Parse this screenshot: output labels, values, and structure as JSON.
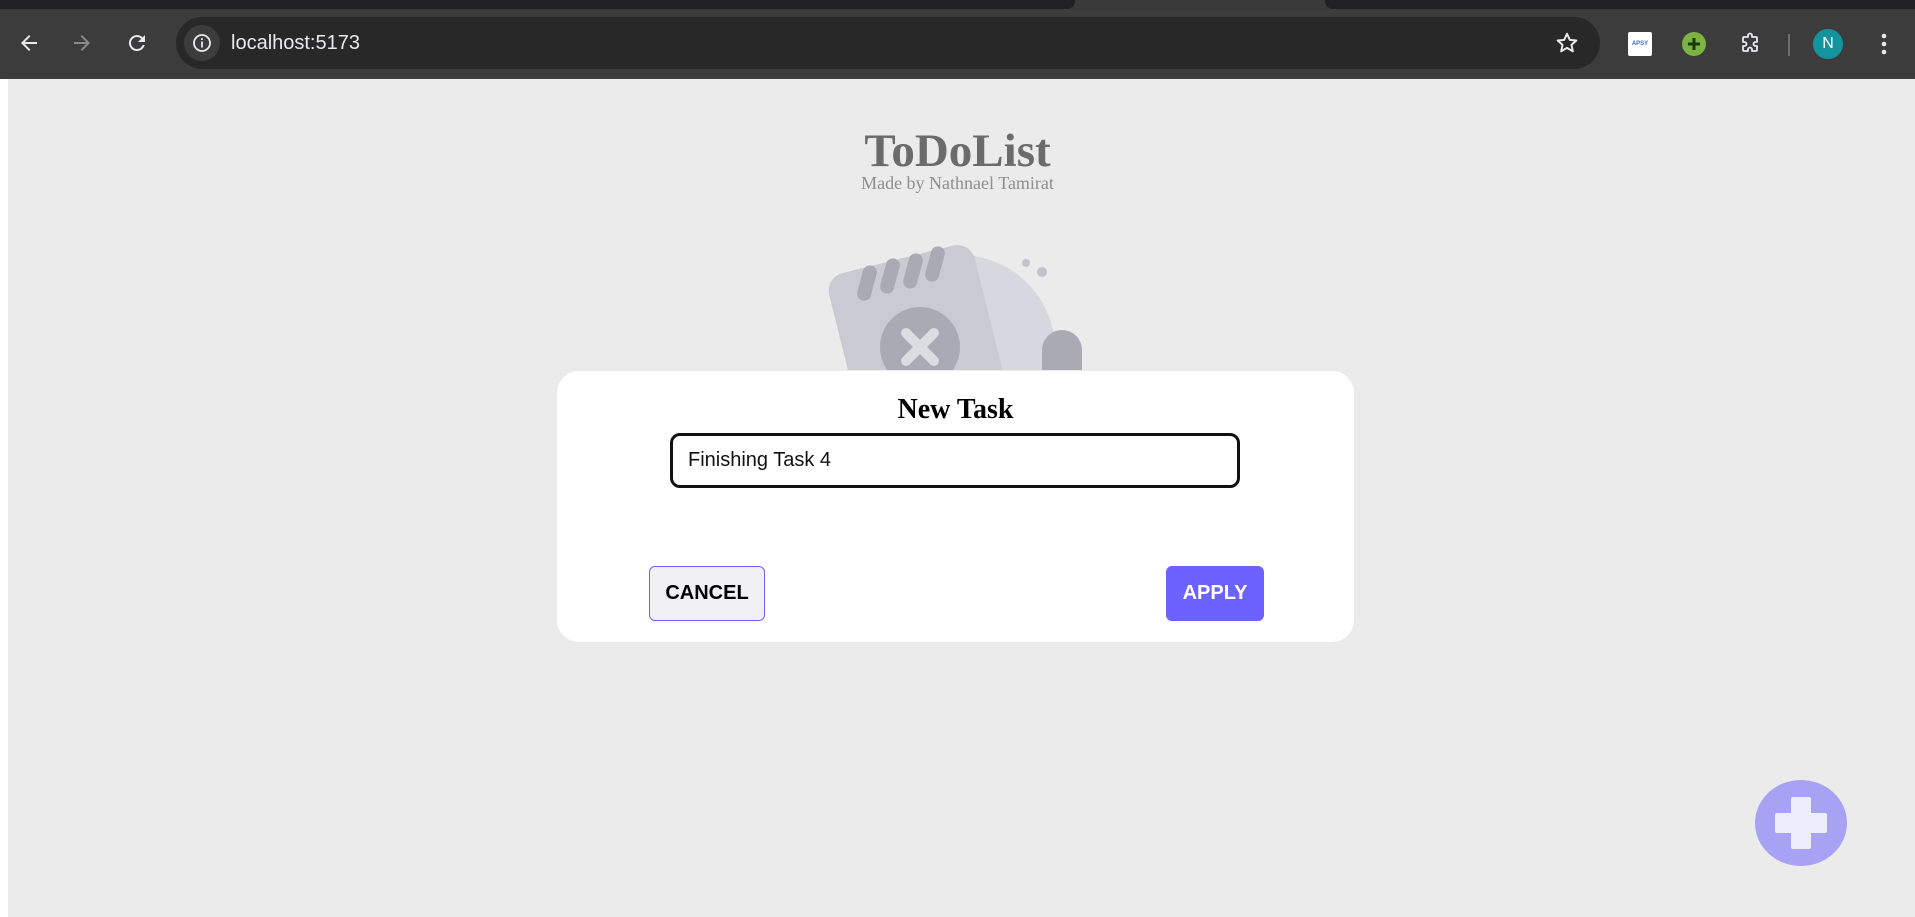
{
  "browser": {
    "url": "localhost:5173",
    "profile_initial": "N",
    "extensions": [
      {
        "name": "apsy-extension-icon",
        "label": "APSY"
      },
      {
        "name": "green-plus-extension-icon",
        "label": ""
      }
    ],
    "colors": {
      "toolbar": "#3c3c3c",
      "omnibox": "#282828",
      "avatar": "#14949c"
    }
  },
  "app": {
    "title": "ToDoList",
    "subtitle": "Made by Nathnael Tamirat"
  },
  "modal": {
    "title": "New Task",
    "input_value": "Finishing Task 4",
    "cancel_label": "CANCEL",
    "apply_label": "APPLY"
  },
  "colors": {
    "accent": "#6c63ff",
    "overlay": "#ebebeb",
    "fab": "#a7a2f3"
  },
  "icons": {
    "back": "arrow-left-icon",
    "forward": "arrow-right-icon",
    "reload": "reload-icon",
    "site_info": "info-icon",
    "bookmark": "star-icon",
    "extensions": "puzzle-icon",
    "menu": "kebab-menu-icon",
    "fab": "plus-icon",
    "illustration": "empty-notepad-illustration"
  }
}
